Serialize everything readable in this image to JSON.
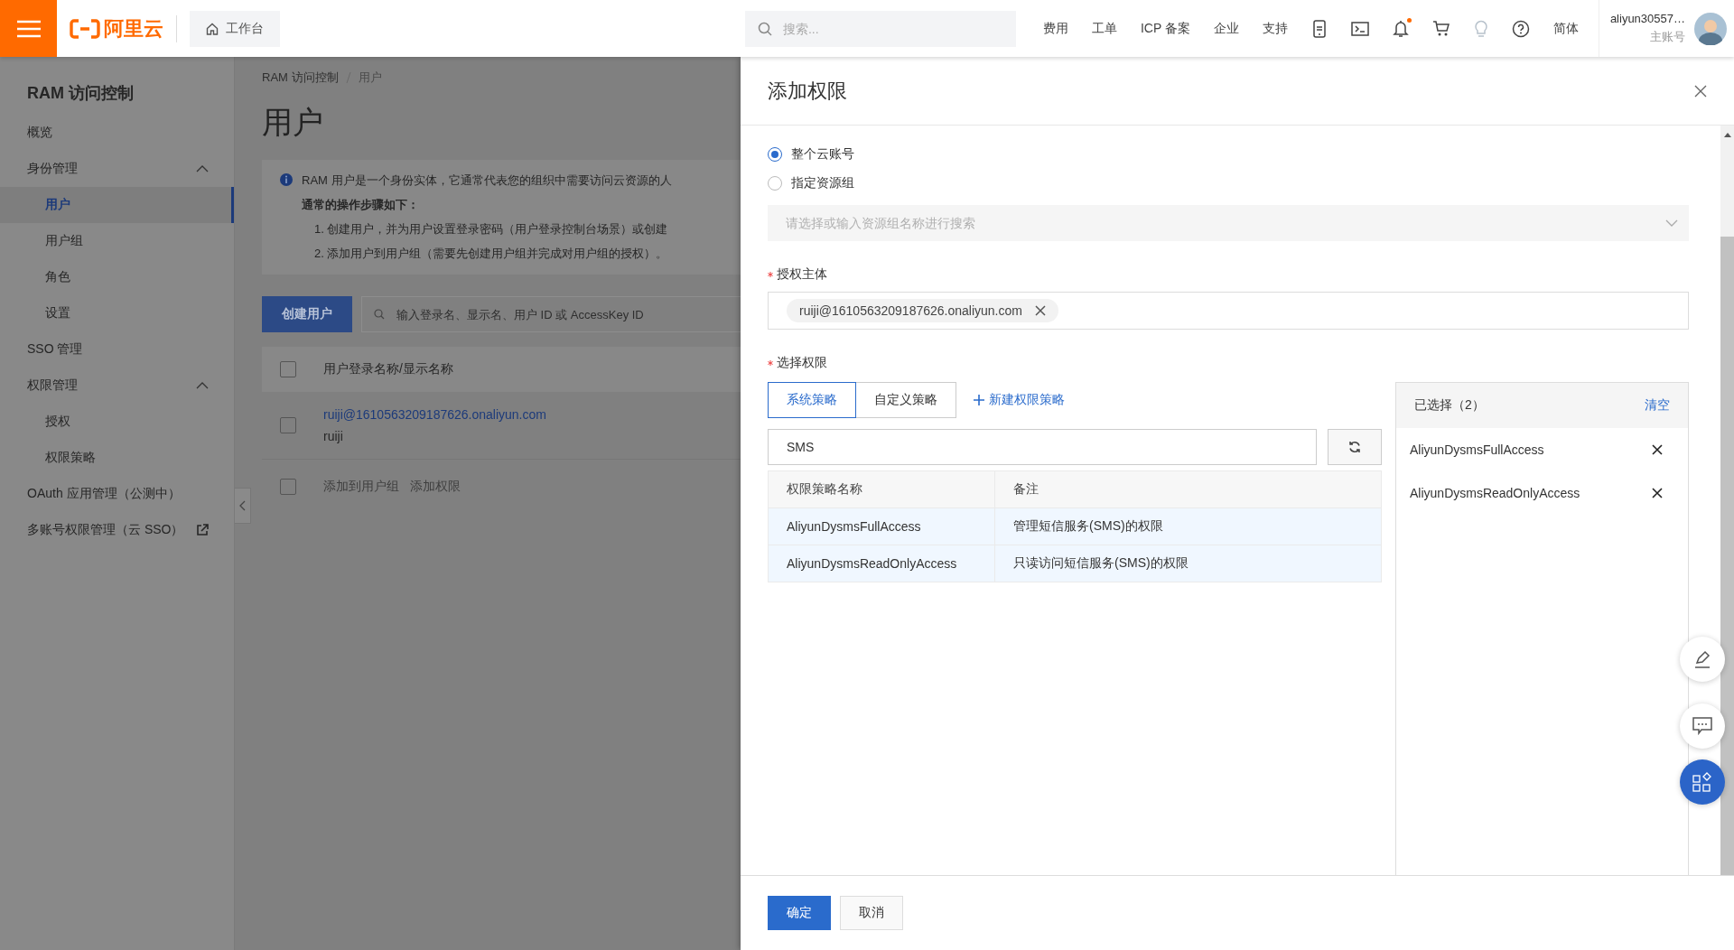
{
  "topbar": {
    "logo": "阿里云",
    "workbench": "工作台",
    "search": {
      "placeholder": "搜索..."
    },
    "nav": [
      "费用",
      "工单",
      "ICP 备案",
      "企业",
      "支持"
    ],
    "notifications": {
      "unread": true
    },
    "language": "简体",
    "account": {
      "name": "aliyun30557…",
      "role": "主账号"
    }
  },
  "sidebar": {
    "title": "RAM 访问控制",
    "items": [
      {
        "label": "概览",
        "kind": "link",
        "selected": false
      },
      {
        "label": "身份管理",
        "kind": "group",
        "selected": false,
        "expanded": true,
        "children": [
          {
            "label": "用户",
            "selected": true
          },
          {
            "label": "用户组",
            "selected": false
          },
          {
            "label": "角色",
            "selected": false
          },
          {
            "label": "设置",
            "selected": false
          }
        ]
      },
      {
        "label": "SSO 管理",
        "kind": "link",
        "selected": false
      },
      {
        "label": "权限管理",
        "kind": "group",
        "selected": false,
        "expanded": true,
        "children": [
          {
            "label": "授权",
            "selected": false
          },
          {
            "label": "权限策略",
            "selected": false
          }
        ]
      },
      {
        "label": "OAuth 应用管理（公测中）",
        "kind": "link",
        "selected": false
      },
      {
        "label": "多账号权限管理（云 SSO）",
        "kind": "external",
        "selected": false
      }
    ]
  },
  "main": {
    "breadcrumb": [
      "RAM 访问控制",
      "用户"
    ],
    "title": "用户",
    "info": {
      "text": "RAM 用户是一个身份实体，它通常代表您的组织中需要访问云资源的人",
      "heading": "通常的操作步骤如下：",
      "steps": [
        "1. 创建用户，并为用户设置登录密码（用户登录控制台场景）或创建",
        "2. 添加用户到用户组（需要先创建用户组并完成对用户组的授权）。"
      ]
    },
    "create_button": "创建用户",
    "search": {
      "placeholder": "输入登录名、显示名、用户 ID 或 AccessKey ID"
    },
    "table": {
      "header_checked": false,
      "columns": [
        "用户登录名称/显示名称"
      ],
      "rows": [
        {
          "login": "ruiji@1610563209187626.onaliyun.com",
          "display": "ruiji",
          "checked": false
        }
      ]
    },
    "batch": {
      "checked": false,
      "actions": [
        {
          "label": "添加到用户组",
          "disabled": true
        },
        {
          "label": "添加权限",
          "disabled": true
        }
      ]
    }
  },
  "drawer": {
    "title": "添加权限",
    "scope": [
      {
        "label": "整个云账号",
        "selected": true
      },
      {
        "label": "指定资源组",
        "selected": false
      }
    ],
    "resource_group": {
      "placeholder": "请选择或输入资源组名称进行搜索",
      "disabled": true
    },
    "principal": {
      "label": "授权主体",
      "required": true,
      "tags": [
        "ruiji@1610563209187626.onaliyun.com"
      ]
    },
    "permissions": {
      "label": "选择权限",
      "required": true,
      "tabs": [
        {
          "label": "系统策略",
          "selected": true
        },
        {
          "label": "自定义策略",
          "selected": false
        }
      ],
      "new_policy": "新建权限策略",
      "search": {
        "value": "SMS"
      },
      "columns": [
        "权限策略名称",
        "备注"
      ],
      "rows": [
        {
          "name": "AliyunDysmsFullAccess",
          "note": "管理短信服务(SMS)的权限",
          "selected": true
        },
        {
          "name": "AliyunDysmsReadOnlyAccess",
          "note": "只读访问短信服务(SMS)的权限",
          "selected": true
        }
      ],
      "chosen": {
        "title": "已选择（2）",
        "clear": "清空",
        "items": [
          "AliyunDysmsFullAccess",
          "AliyunDysmsReadOnlyAccess"
        ]
      }
    },
    "buttons": [
      {
        "label": "确定",
        "kind": "primary"
      },
      {
        "label": "取消",
        "kind": "default"
      }
    ]
  }
}
